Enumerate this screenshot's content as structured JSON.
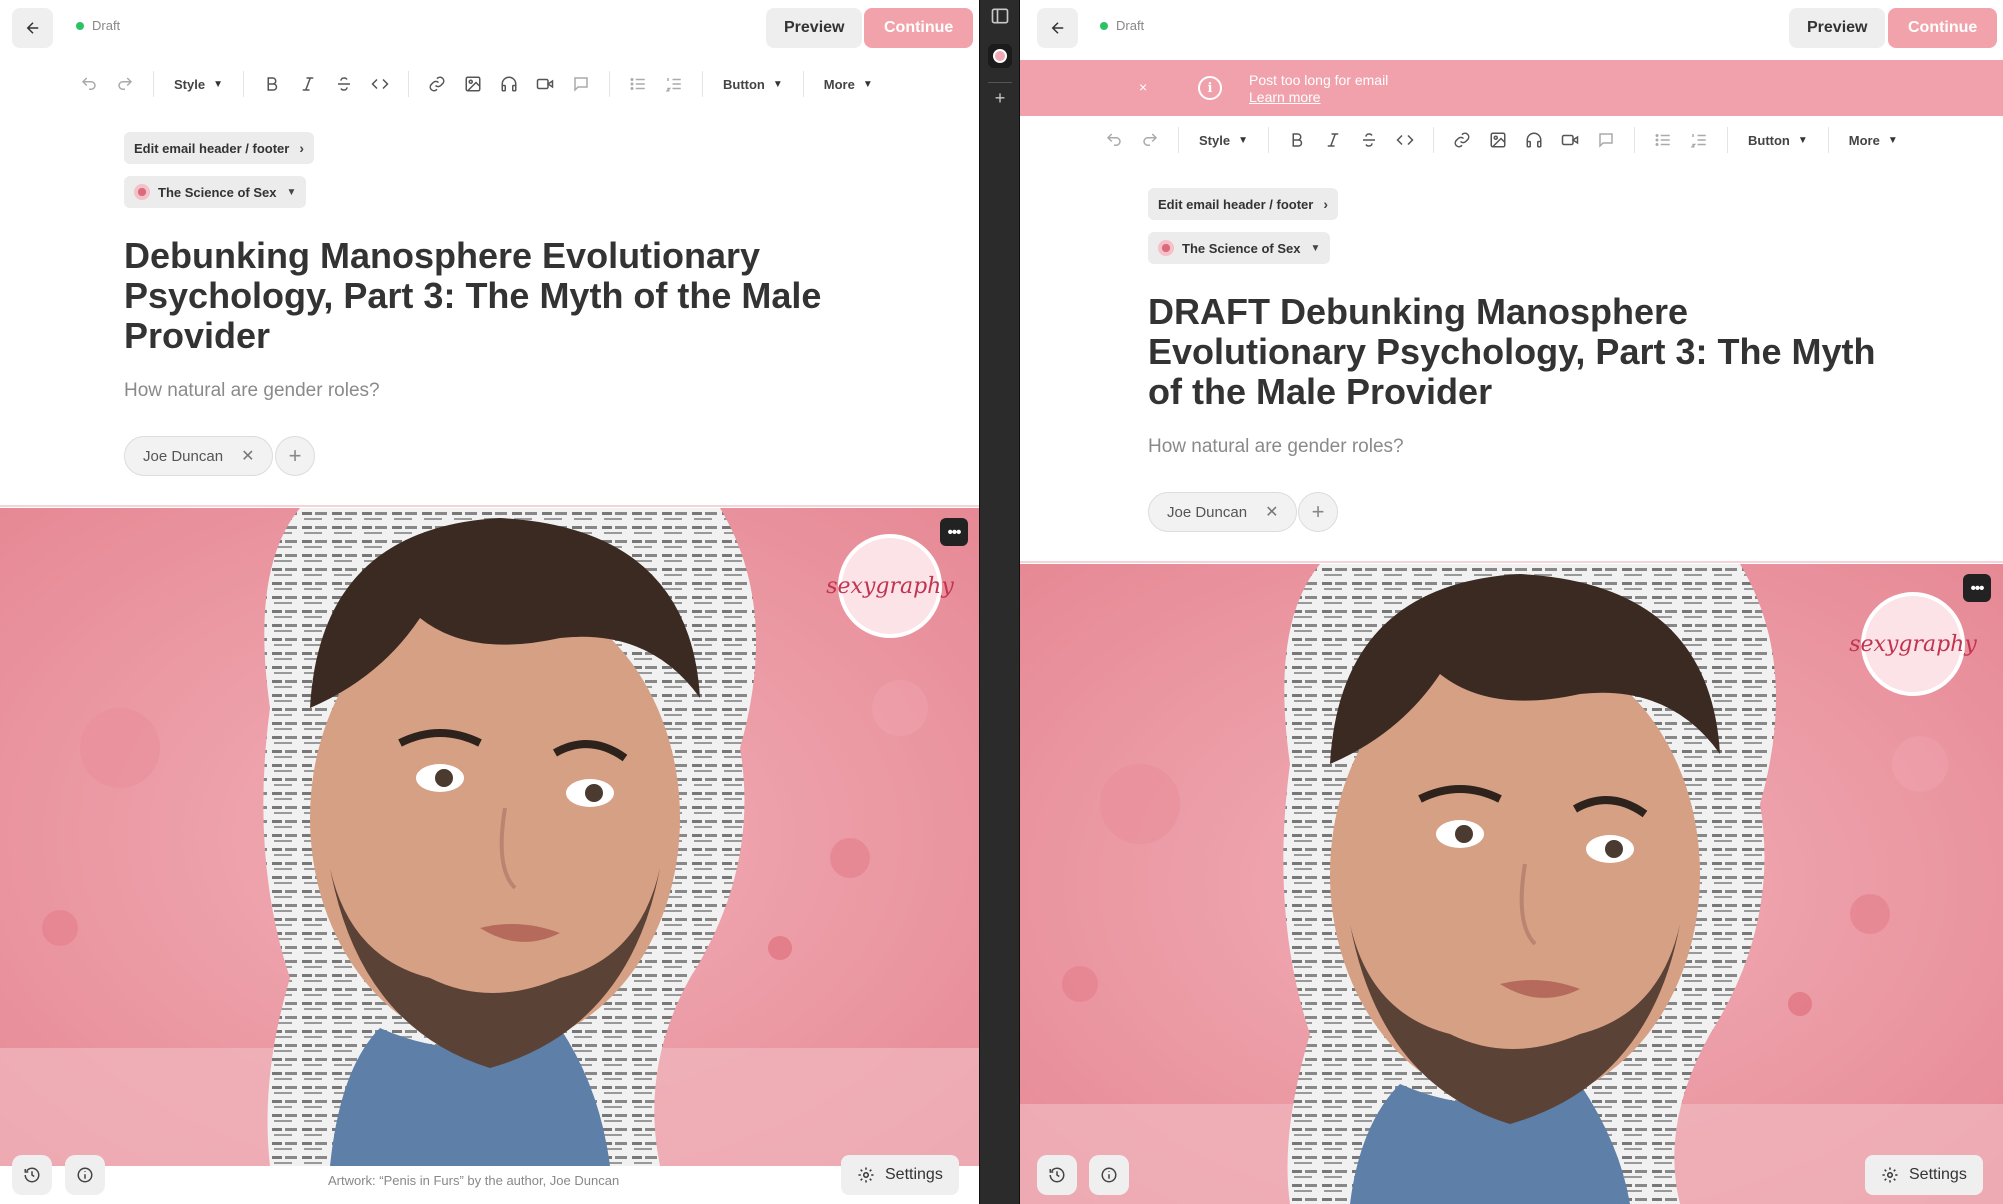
{
  "left": {
    "status": "Draft",
    "preview_label": "Preview",
    "continue_label": "Continue",
    "toolbar": {
      "style_label": "Style",
      "button_label": "Button",
      "more_label": "More"
    },
    "edit_header_label": "Edit email header / footer",
    "publication_name": "The Science of Sex",
    "title": "Debunking Manosphere Evolutionary Psychology, Part 3: The Myth of the Male Provider",
    "subtitle": "How natural are gender roles?",
    "author": "Joe Duncan",
    "caption": "Artwork: “Penis in Furs” by the author, Joe Duncan",
    "settings_label": "Settings",
    "logo_text": "sexygraphy"
  },
  "right": {
    "status": "Draft",
    "preview_label": "Preview",
    "continue_label": "Continue",
    "banner": {
      "message": "Post too long for email",
      "link": "Learn more",
      "close": "×",
      "info": "i"
    },
    "toolbar": {
      "style_label": "Style",
      "button_label": "Button",
      "more_label": "More"
    },
    "edit_header_label": "Edit email header / footer",
    "publication_name": "The Science of Sex",
    "title": "DRAFT Debunking Manosphere Evolutionary Psychology, Part 3: The Myth of the Male Provider",
    "subtitle": "How natural are gender roles?",
    "author": "Joe Duncan",
    "settings_label": "Settings",
    "logo_text": "sexygraphy"
  },
  "colors": {
    "accent": "#f2a2aa",
    "banner": "#f0a1ab",
    "status_dot": "#2cc167",
    "image_bg": "#eb9ba4"
  }
}
